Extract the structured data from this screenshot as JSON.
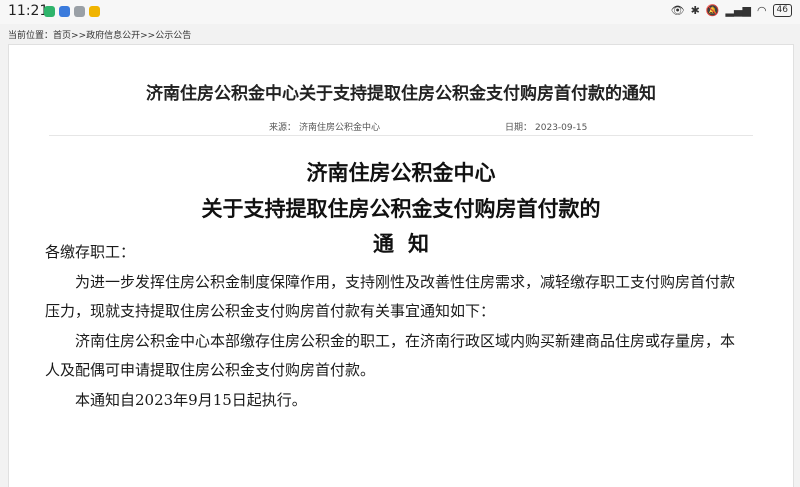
{
  "status_bar": {
    "time": "11:21",
    "battery": "46",
    "app_icon_colors": [
      "#2fb46b",
      "#3b7bdc",
      "#9aa0a6",
      "#f0b400"
    ]
  },
  "breadcrumb": {
    "prefix": "当前位置：",
    "home": "首页",
    "sep1": ">>",
    "section": "政府信息公开",
    "sep2": ">>",
    "current": "公示公告"
  },
  "article": {
    "page_title": "济南住房公积金中心关于支持提取住房公积金支付购房首付款的通知",
    "source_label": "来源：",
    "source": "济南住房公积金中心",
    "date_label": "日期：",
    "date": "2023-09-15",
    "doc_title_line1": "济南住房公积金中心",
    "doc_title_line2": "关于支持提取住房公积金支付购房首付款的",
    "doc_title_line3": "通知",
    "salutation": "各缴存职工：",
    "para1": "为进一步发挥住房公积金制度保障作用，支持刚性及改善性住房需求，减轻缴存职工支付购房首付款压力，现就支持提取住房公积金支付购房首付款有关事宜通知如下：",
    "para2": "济南住房公积金中心本部缴存住房公积金的职工，在济南行政区域内购买新建商品住房或存量房，本人及配偶可申请提取住房公积金支付购房首付款。",
    "para3": "本通知自2023年9月15日起执行。"
  }
}
